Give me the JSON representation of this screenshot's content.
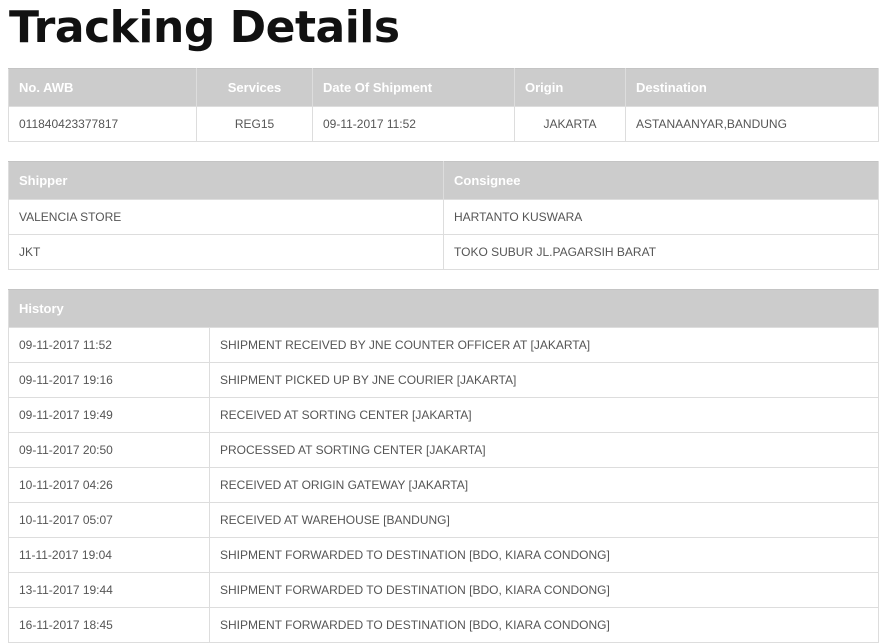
{
  "page": {
    "title": "Tracking Details"
  },
  "summary": {
    "headers": {
      "awb": "No. AWB",
      "services": "Services",
      "date": "Date Of Shipment",
      "origin": "Origin",
      "destination": "Destination"
    },
    "row": {
      "awb": "011840423377817",
      "services": "REG15",
      "date": "09-11-2017 11:52",
      "origin": "JAKARTA",
      "destination": "ASTANAANYAR,BANDUNG"
    }
  },
  "parties": {
    "headers": {
      "shipper": "Shipper",
      "consignee": "Consignee"
    },
    "rows": [
      {
        "shipper": "VALENCIA STORE",
        "consignee": "HARTANTO KUSWARA"
      },
      {
        "shipper": "JKT",
        "consignee": "TOKO SUBUR JL.PAGARSIH BARAT"
      }
    ]
  },
  "history": {
    "header": "History",
    "rows": [
      {
        "time": "09-11-2017 11:52",
        "event": "SHIPMENT RECEIVED BY JNE COUNTER OFFICER AT [JAKARTA]"
      },
      {
        "time": "09-11-2017 19:16",
        "event": "SHIPMENT PICKED UP BY JNE COURIER [JAKARTA]"
      },
      {
        "time": "09-11-2017 19:49",
        "event": "RECEIVED AT SORTING CENTER [JAKARTA]"
      },
      {
        "time": "09-11-2017 20:50",
        "event": "PROCESSED AT SORTING CENTER [JAKARTA]"
      },
      {
        "time": "10-11-2017 04:26",
        "event": "RECEIVED AT ORIGIN GATEWAY [JAKARTA]"
      },
      {
        "time": "10-11-2017 05:07",
        "event": "RECEIVED AT WAREHOUSE [BANDUNG]"
      },
      {
        "time": "11-11-2017 19:04",
        "event": "SHIPMENT FORWARDED TO DESTINATION [BDO, KIARA CONDONG]"
      },
      {
        "time": "13-11-2017 19:44",
        "event": "SHIPMENT FORWARDED TO DESTINATION [BDO, KIARA CONDONG]"
      },
      {
        "time": "16-11-2017 18:45",
        "event": "SHIPMENT FORWARDED TO DESTINATION [BDO, KIARA CONDONG]"
      }
    ]
  },
  "colors": {
    "header_bg": "#cccccc",
    "header_text": "#ffffff",
    "border": "#dddddd",
    "body_text": "#555555",
    "title_text": "#111111"
  }
}
